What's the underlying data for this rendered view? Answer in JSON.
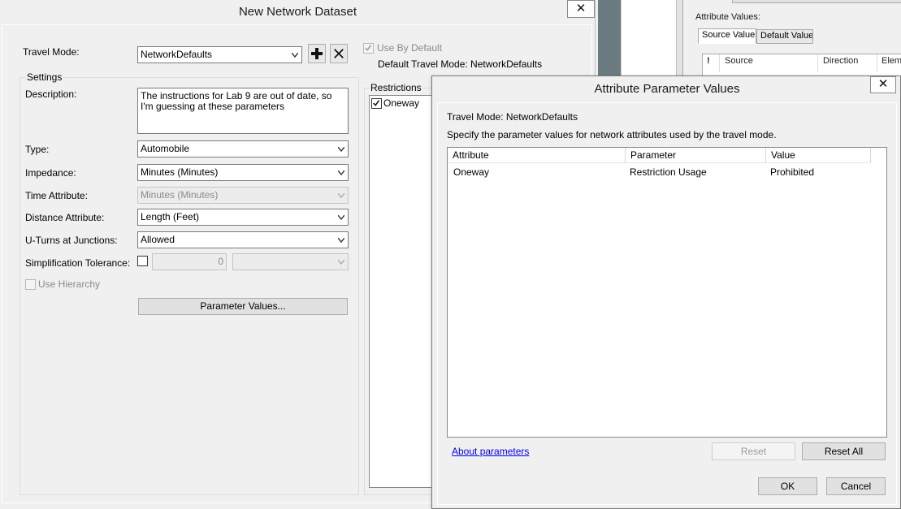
{
  "background": {
    "attribute_values_label": "Attribute Values:",
    "tabs": [
      {
        "label": "Source Values",
        "active": true
      },
      {
        "label": "Default Values",
        "active": false
      }
    ],
    "grid_columns": [
      "!",
      "Source",
      "Direction",
      "Eleme"
    ]
  },
  "main_dialog": {
    "title": "New Network Dataset",
    "close_label": "✕",
    "travel_mode_label": "Travel Mode:",
    "travel_mode_value": "NetworkDefaults",
    "use_by_default_label": "Use By Default",
    "use_by_default_checked": true,
    "default_travel_mode_text": "Default Travel Mode: NetworkDefaults",
    "settings_label": "Settings",
    "description_label": "Description:",
    "description_value": "The instructions for Lab 9 are out of date, so I'm guessing at these parameters",
    "type_label": "Type:",
    "type_value": "Automobile",
    "impedance_label": "Impedance:",
    "impedance_value": "Minutes (Minutes)",
    "time_attribute_label": "Time Attribute:",
    "time_attribute_value": "Minutes (Minutes)",
    "distance_attribute_label": "Distance Attribute:",
    "distance_attribute_value": "Length (Feet)",
    "uturns_label": "U-Turns at Junctions:",
    "uturns_value": "Allowed",
    "simplification_label": "Simplification Tolerance:",
    "simplification_value": "0",
    "simplification_units": "",
    "use_hierarchy_label": "Use Hierarchy",
    "parameter_values_button": "Parameter Values...",
    "restrictions_label": "Restrictions",
    "restrictions": [
      {
        "label": "Oneway",
        "checked": true
      }
    ]
  },
  "attr_dialog": {
    "title": "Attribute Parameter Values",
    "close_label": "✕",
    "travel_mode_text": "Travel Mode: NetworkDefaults",
    "instructions": "Specify the parameter values for network attributes used by the travel mode.",
    "columns": [
      "Attribute",
      "Parameter",
      "Value"
    ],
    "rows": [
      {
        "attribute": "Oneway",
        "parameter": "Restriction Usage",
        "value": "Prohibited"
      }
    ],
    "about_link": "About parameters",
    "reset_button": "Reset",
    "reset_all_button": "Reset All",
    "ok_button": "OK",
    "cancel_button": "Cancel"
  }
}
